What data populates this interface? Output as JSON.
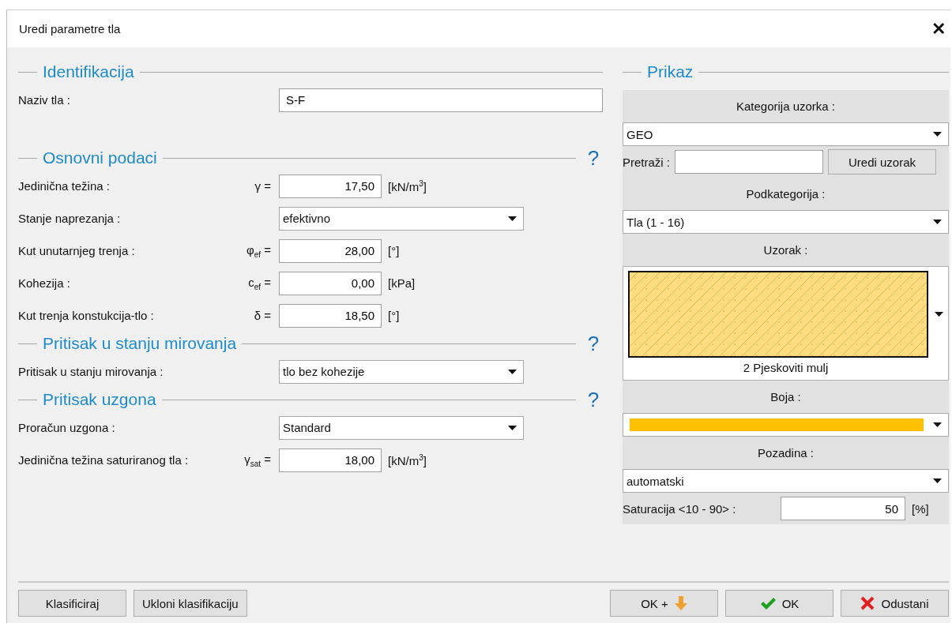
{
  "window": {
    "title": "Uredi parametre tla",
    "close": "✕"
  },
  "sections": [
    {
      "title": "Identifikacija",
      "rows": [
        {
          "kind": "text",
          "label": "Naziv tla :",
          "value": "S-F"
        }
      ]
    },
    {
      "title": "Osnovni podaci",
      "help": "?",
      "rows": [
        {
          "kind": "number",
          "label": "Jedinična težina :",
          "symbol": "γ =",
          "value": "17,50",
          "unit": "[kN/m$^{3}$]"
        },
        {
          "kind": "select",
          "label": "Stanje naprezanja :",
          "value": "efektivno"
        },
        {
          "kind": "number",
          "label": "Kut unutarnjeg trenja :",
          "symbol": "φ$_{ef}$ =",
          "value": "28,00",
          "unit": "[°]"
        },
        {
          "kind": "number",
          "label": "Kohezija :",
          "symbol": "c$_{ef}$ =",
          "value": "0,00",
          "unit": "[kPa]"
        },
        {
          "kind": "number",
          "label": "Kut trenja konstukcija-tlo :",
          "symbol": "δ =",
          "value": "18,50",
          "unit": "[°]"
        }
      ]
    },
    {
      "title": "Pritisak u stanju mirovanja",
      "help": "?",
      "rows": [
        {
          "kind": "select",
          "label": "Pritisak u stanju mirovanja :",
          "value": "tlo bez kohezije"
        }
      ]
    },
    {
      "title": "Pritisak uzgona",
      "help": "?",
      "rows": [
        {
          "kind": "select",
          "label": "Proračun uzgona :",
          "value": "Standard"
        },
        {
          "kind": "number",
          "label": "Jedinična težina saturiranog tla :",
          "symbol": "γ$_{sat}$ =",
          "value": "18,00",
          "unit": "[kN/m$^{3}$]"
        }
      ]
    }
  ],
  "display": {
    "title": "Prikaz",
    "items": [
      {
        "kind": "heading",
        "text": "Kategorija uzorka :"
      },
      {
        "kind": "select",
        "value": "GEO"
      },
      {
        "kind": "search",
        "label": "Pretraži :",
        "button": "Uredi uzorak"
      },
      {
        "kind": "heading",
        "text": "Podkategorija :"
      },
      {
        "kind": "select",
        "value": "Tla (1 - 16)"
      },
      {
        "kind": "heading",
        "text": "Uzorak :"
      },
      {
        "kind": "pattern",
        "caption": "2 Pjeskoviti mulj"
      },
      {
        "kind": "heading",
        "text": "Boja :"
      },
      {
        "kind": "color",
        "color": "#ffc000"
      },
      {
        "kind": "heading",
        "text": "Pozadina :"
      },
      {
        "kind": "select",
        "value": "automatski"
      },
      {
        "kind": "number",
        "label": "Saturacija <10 - 90> :",
        "value": "50",
        "unit": "[%]"
      }
    ]
  },
  "footer": {
    "left_buttons": [
      {
        "label": "Klasificiraj"
      },
      {
        "label": "Ukloni klasifikaciju"
      }
    ],
    "right_buttons": [
      {
        "label": "OK +",
        "kind": "add"
      },
      {
        "label": "OK",
        "kind": "confirm"
      },
      {
        "label": "Odustani",
        "kind": "cancel"
      }
    ]
  }
}
